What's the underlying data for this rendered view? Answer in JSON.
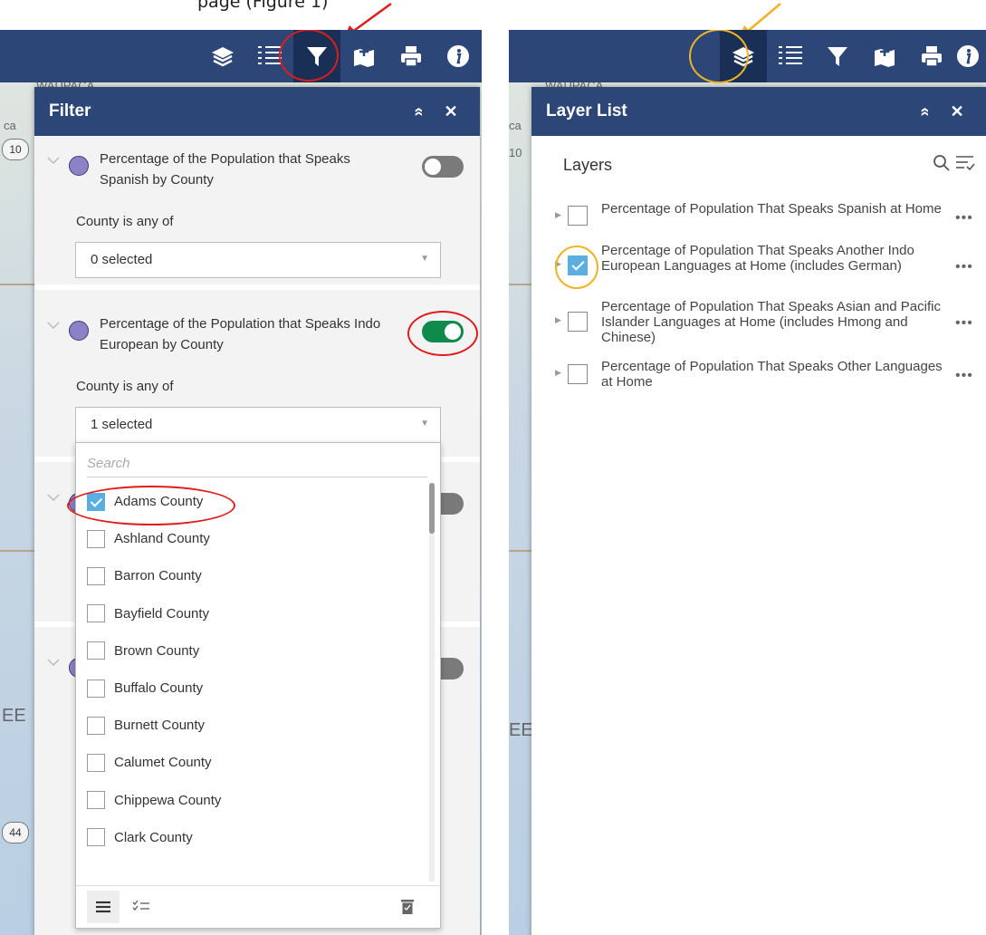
{
  "caption": {
    "text": "page (Figure 1)"
  },
  "map": {
    "labels": [
      "WAUPACA",
      "ca",
      "10",
      "EE",
      "44"
    ]
  },
  "toolbar": {
    "icons": [
      "layers-icon",
      "legend-list-icon",
      "filter-icon",
      "add-data-icon",
      "print-icon",
      "info-icon"
    ]
  },
  "filter_panel": {
    "title": "Filter",
    "collapse_glyph": "»",
    "close_glyph": "✕",
    "filters": [
      {
        "title": "Percentage of the Population that Speaks Spanish by County",
        "condition": "County is any of",
        "selected_text": "0 selected",
        "enabled": false
      },
      {
        "title": "Percentage of the Population that Speaks Indo European by County",
        "condition": "County is any of",
        "selected_text": "1 selected",
        "enabled": true
      }
    ],
    "dropdown": {
      "search_placeholder": "Search",
      "options": [
        {
          "label": "Adams County",
          "checked": true
        },
        {
          "label": "Ashland County",
          "checked": false
        },
        {
          "label": "Barron County",
          "checked": false
        },
        {
          "label": "Bayfield County",
          "checked": false
        },
        {
          "label": "Brown County",
          "checked": false
        },
        {
          "label": "Buffalo County",
          "checked": false
        },
        {
          "label": "Burnett County",
          "checked": false
        },
        {
          "label": "Calumet County",
          "checked": false
        },
        {
          "label": "Chippewa County",
          "checked": false
        },
        {
          "label": "Clark County",
          "checked": false
        }
      ]
    }
  },
  "layer_list_panel": {
    "title": "Layer List",
    "collapse_glyph": "»",
    "close_glyph": "✕",
    "section_label": "Layers",
    "layers": [
      {
        "name": "Percentage of Population That Speaks Spanish at Home",
        "checked": false
      },
      {
        "name": "Percentage of Population That Speaks Another Indo European Languages at Home (includes German)",
        "checked": true
      },
      {
        "name": "Percentage of Population That Speaks Asian and Pacific Islander Languages at Home (includes Hmong and Chinese)",
        "checked": false
      },
      {
        "name": "Percentage of Population That Speaks Other Languages at Home",
        "checked": false
      }
    ],
    "more_glyph": "•••"
  },
  "colors": {
    "toolbar": "#2b4677",
    "toolbar_active": "#1a2f55",
    "toggle_on": "#0d8a4c",
    "checkbox_checked": "#5aaee0",
    "annotation_red": "#e01c1c",
    "annotation_yellow": "#f0b323"
  }
}
